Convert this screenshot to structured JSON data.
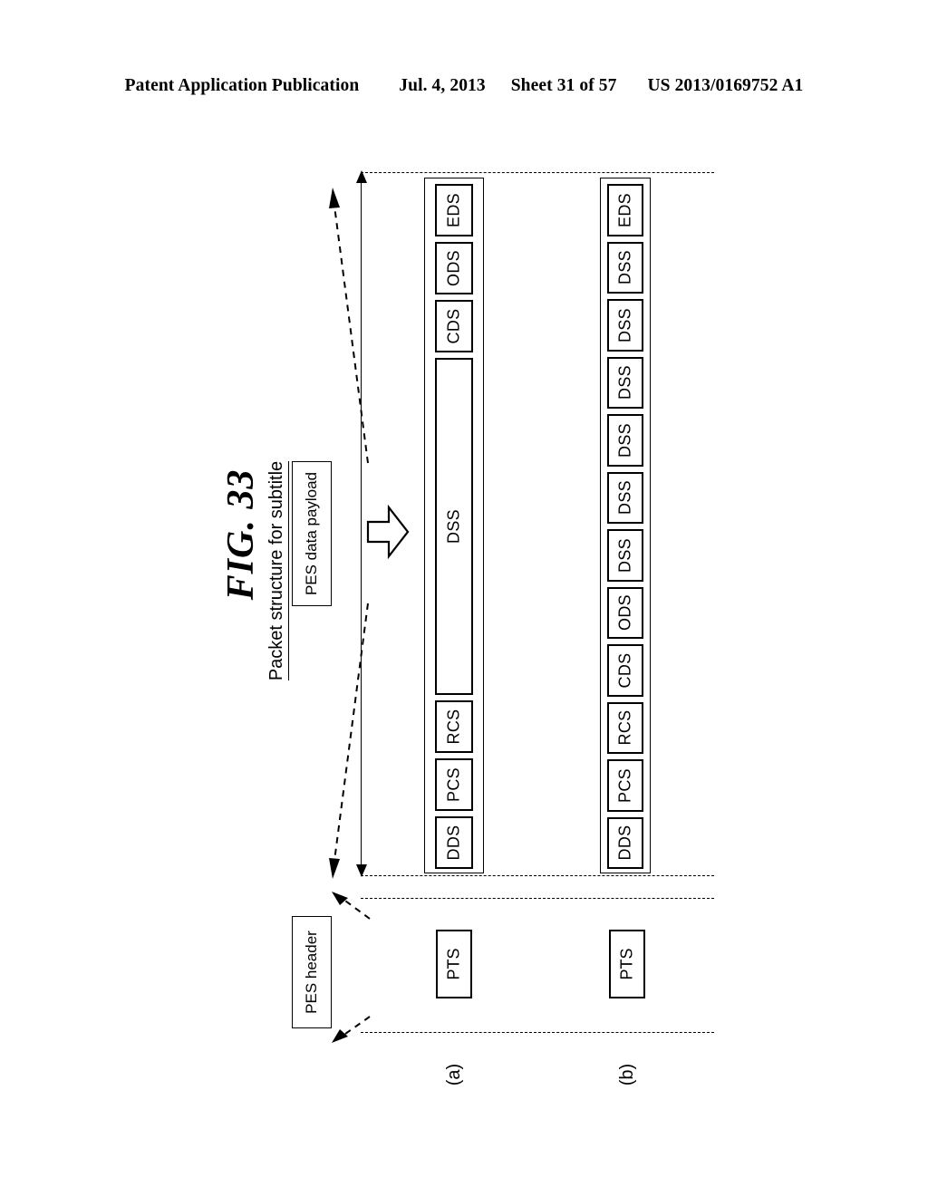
{
  "header": {
    "publication": "Patent Application Publication",
    "date": "Jul. 4, 2013",
    "sheet": "Sheet 31 of 57",
    "number": "US 2013/0169752 A1"
  },
  "figure": {
    "number": "FIG. 33",
    "caption": "Packet structure for subtitle"
  },
  "callouts": {
    "payload": "PES data payload",
    "header": "PES header"
  },
  "rows": [
    {
      "tag": "(a)",
      "pts_label": "PTS",
      "segments": [
        {
          "label": "DDS",
          "long": false
        },
        {
          "label": "PCS",
          "long": false
        },
        {
          "label": "RCS",
          "long": false
        },
        {
          "label": "DSS",
          "long": true
        },
        {
          "label": "CDS",
          "long": false
        },
        {
          "label": "ODS",
          "long": false
        },
        {
          "label": "EDS",
          "long": false
        }
      ]
    },
    {
      "tag": "(b)",
      "pts_label": "PTS",
      "segments": [
        {
          "label": "DDS",
          "long": false
        },
        {
          "label": "PCS",
          "long": false
        },
        {
          "label": "RCS",
          "long": false
        },
        {
          "label": "CDS",
          "long": false
        },
        {
          "label": "ODS",
          "long": false
        },
        {
          "label": "DSS",
          "long": false
        },
        {
          "label": "DSS",
          "long": false
        },
        {
          "label": "DSS",
          "long": false
        },
        {
          "label": "DSS",
          "long": false
        },
        {
          "label": "DSS",
          "long": false
        },
        {
          "label": "DSS",
          "long": false
        },
        {
          "label": "EDS",
          "long": false
        }
      ]
    }
  ],
  "colors": {
    "ink": "#000000",
    "paper": "#ffffff"
  }
}
